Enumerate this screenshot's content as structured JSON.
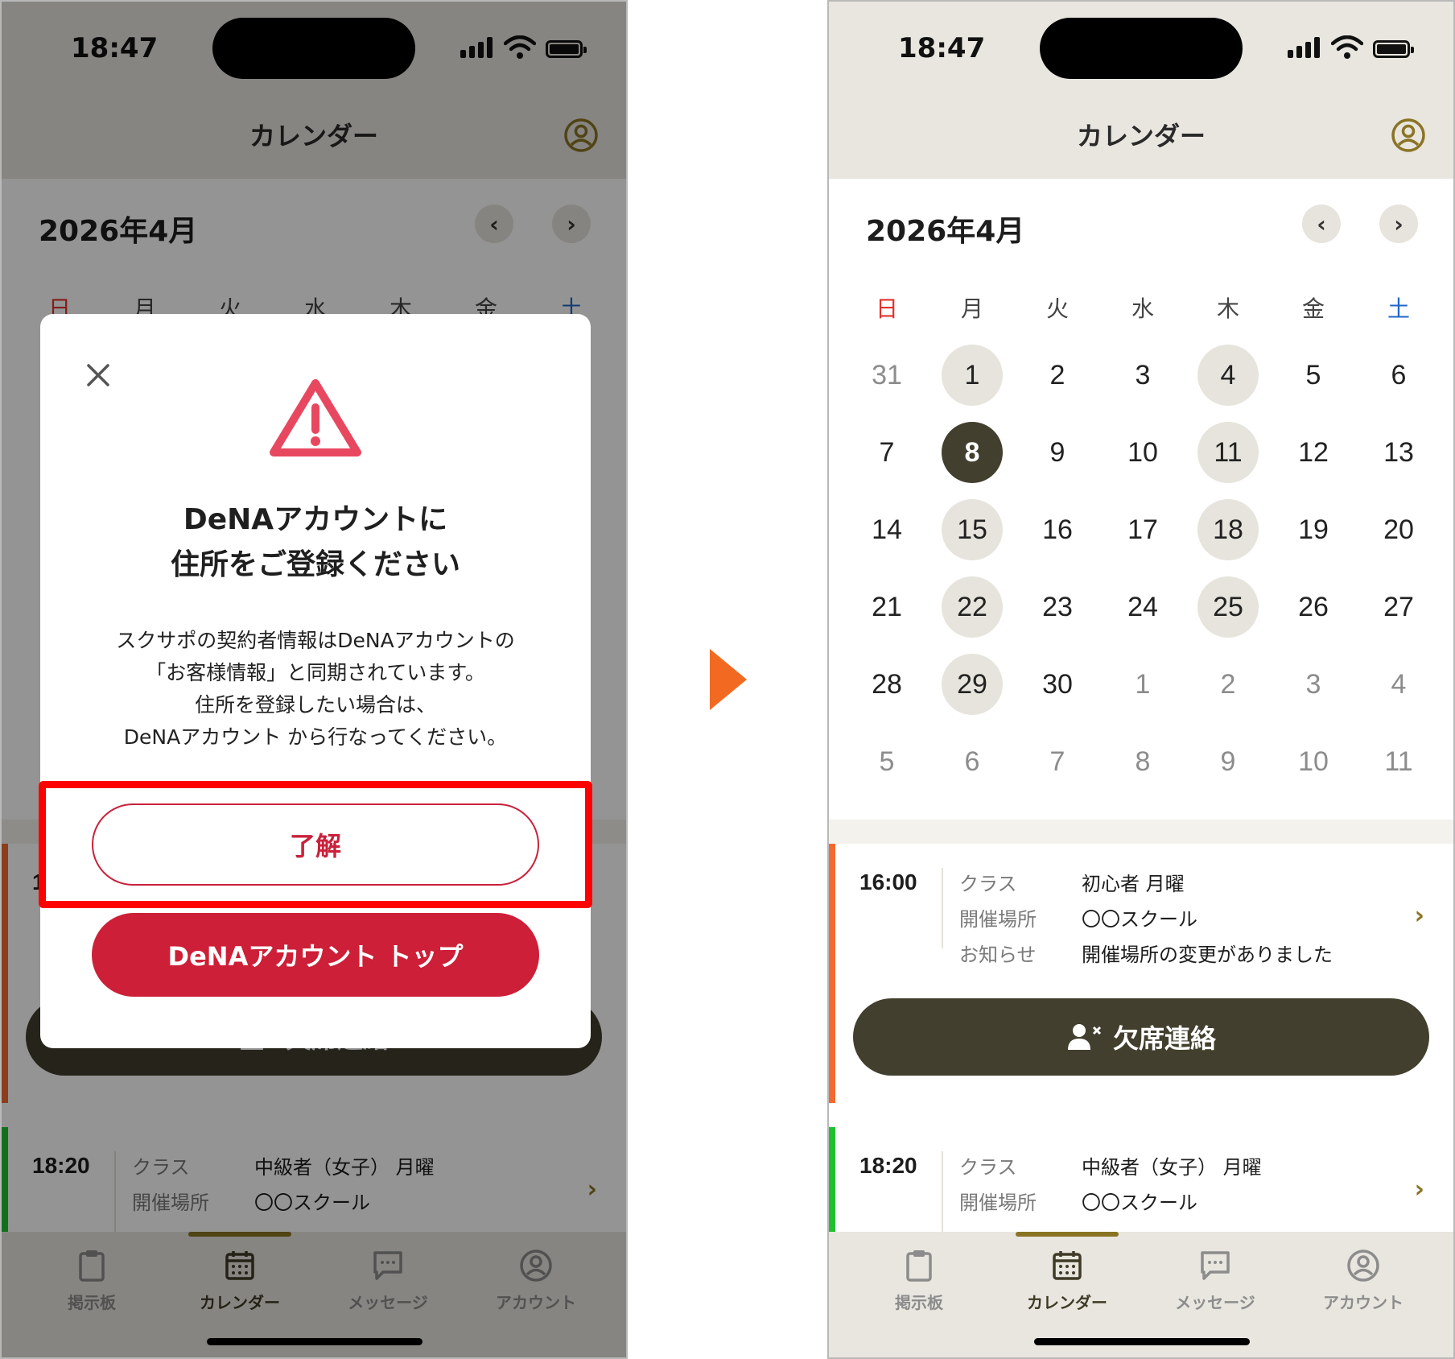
{
  "status_bar": {
    "time": "18:47"
  },
  "nav": {
    "title": "カレンダー",
    "account_icon": "account-circle-icon"
  },
  "calendar": {
    "month_title": "2026年4月",
    "prev_icon": "chevron-left-icon",
    "next_icon": "chevron-right-icon",
    "prev_symbol": "‹",
    "next_symbol": "›",
    "weekdays": [
      "日",
      "月",
      "火",
      "水",
      "木",
      "金",
      "土"
    ],
    "weeks": [
      [
        {
          "d": "31",
          "o": true
        },
        {
          "d": "1",
          "e": true
        },
        {
          "d": "2"
        },
        {
          "d": "3"
        },
        {
          "d": "4",
          "e": true
        },
        {
          "d": "5"
        },
        {
          "d": "6"
        }
      ],
      [
        {
          "d": "7"
        },
        {
          "d": "8",
          "s": true
        },
        {
          "d": "9"
        },
        {
          "d": "10"
        },
        {
          "d": "11",
          "e": true
        },
        {
          "d": "12"
        },
        {
          "d": "13"
        }
      ],
      [
        {
          "d": "14"
        },
        {
          "d": "15",
          "e": true
        },
        {
          "d": "16"
        },
        {
          "d": "17"
        },
        {
          "d": "18",
          "e": true
        },
        {
          "d": "19"
        },
        {
          "d": "20"
        }
      ],
      [
        {
          "d": "21"
        },
        {
          "d": "22",
          "e": true
        },
        {
          "d": "23"
        },
        {
          "d": "24"
        },
        {
          "d": "25",
          "e": true
        },
        {
          "d": "26"
        },
        {
          "d": "27"
        }
      ],
      [
        {
          "d": "28"
        },
        {
          "d": "29",
          "e": true
        },
        {
          "d": "30"
        },
        {
          "d": "1",
          "o": true
        },
        {
          "d": "2",
          "o": true
        },
        {
          "d": "3",
          "o": true
        },
        {
          "d": "4",
          "o": true
        }
      ],
      [
        {
          "d": "5",
          "o": true
        },
        {
          "d": "6",
          "o": true
        },
        {
          "d": "7",
          "o": true
        },
        {
          "d": "8",
          "o": true
        },
        {
          "d": "9",
          "o": true
        },
        {
          "d": "10",
          "o": true
        },
        {
          "d": "11",
          "o": true
        }
      ]
    ]
  },
  "events": [
    {
      "time": "16:00",
      "stripe_color": "#f26a30",
      "rows": [
        {
          "label": "クラス",
          "value": "初心者 月曜"
        },
        {
          "label": "開催場所",
          "value": "〇〇スクール"
        },
        {
          "label": "お知らせ",
          "value": "開催場所の変更がありました"
        }
      ],
      "absence_button": "欠席連絡"
    },
    {
      "time": "18:20",
      "stripe_color": "#1fc12f",
      "rows": [
        {
          "label": "クラス",
          "value": "中級者（女子） 月曜"
        },
        {
          "label": "開催場所",
          "value": "〇〇スクール"
        }
      ]
    }
  ],
  "tabs": [
    {
      "label": "掲示板",
      "icon": "clipboard-icon",
      "active": false
    },
    {
      "label": "カレンダー",
      "icon": "calendar-icon",
      "active": true
    },
    {
      "label": "メッセージ",
      "icon": "message-icon",
      "active": false
    },
    {
      "label": "アカウント",
      "icon": "account-circle-icon",
      "active": false
    }
  ],
  "modal": {
    "close_icon": "close-icon",
    "warning_icon": "warning-icon",
    "title_line1": "DeNAアカウントに",
    "title_line2": "住所をご登録ください",
    "body_line1": "スクサポの契約者情報はDeNAアカウントの",
    "body_line2": "「お客様情報」と同期されています。",
    "body_line3": "住所を登録したい場合は、",
    "body_line4": "DeNAアカウント から行なってください。",
    "ok_button": "了解",
    "top_button": "DeNAアカウント トップ"
  },
  "colors": {
    "accent_gold": "#8a7424",
    "dark_olive": "#423f2e",
    "brand_red": "#cd1f37",
    "highlight_red": "#ff0000",
    "transition_arrow": "#f26a21"
  },
  "transition_icon": "play-arrow-icon"
}
